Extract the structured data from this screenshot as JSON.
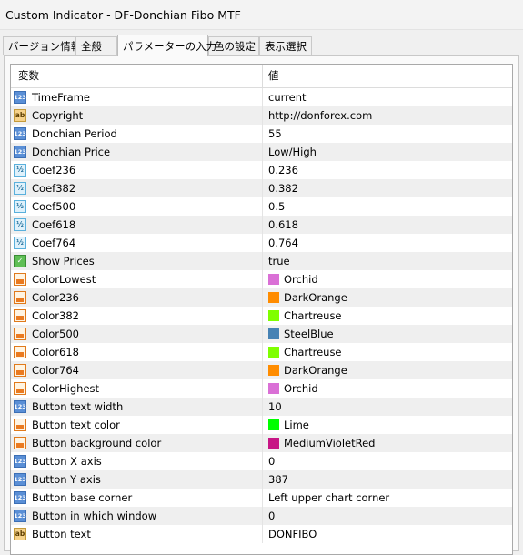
{
  "window": {
    "title": "Custom Indicator - DF-Donchian Fibo MTF"
  },
  "tabs": [
    {
      "label": "バージョン情報"
    },
    {
      "label": "全般"
    },
    {
      "label": "パラメーターの入力"
    },
    {
      "label": "色の設定"
    },
    {
      "label": "表示選択"
    }
  ],
  "grid": {
    "header": {
      "variable": "変数",
      "value": "値"
    },
    "rows": [
      {
        "icon": "int-icon",
        "name": "TimeFrame",
        "value": "current"
      },
      {
        "icon": "string-icon",
        "name": "Copyright",
        "value": "http://donforex.com"
      },
      {
        "icon": "int-icon",
        "name": "Donchian Period",
        "value": "55"
      },
      {
        "icon": "int-icon",
        "name": "Donchian Price",
        "value": "Low/High"
      },
      {
        "icon": "double-icon",
        "name": "Coef236",
        "value": "0.236"
      },
      {
        "icon": "double-icon",
        "name": "Coef382",
        "value": "0.382"
      },
      {
        "icon": "double-icon",
        "name": "Coef500",
        "value": "0.5"
      },
      {
        "icon": "double-icon",
        "name": "Coef618",
        "value": "0.618"
      },
      {
        "icon": "double-icon",
        "name": "Coef764",
        "value": "0.764"
      },
      {
        "icon": "bool-icon",
        "name": "Show Prices",
        "value": "true"
      },
      {
        "icon": "color-icon",
        "name": "ColorLowest",
        "value": "Orchid",
        "swatch": "#da70d6"
      },
      {
        "icon": "color-icon",
        "name": "Color236",
        "value": "DarkOrange",
        "swatch": "#ff8c00"
      },
      {
        "icon": "color-icon",
        "name": "Color382",
        "value": "Chartreuse",
        "swatch": "#7fff00"
      },
      {
        "icon": "color-icon",
        "name": "Color500",
        "value": "SteelBlue",
        "swatch": "#4682b4"
      },
      {
        "icon": "color-icon",
        "name": "Color618",
        "value": "Chartreuse",
        "swatch": "#7fff00"
      },
      {
        "icon": "color-icon",
        "name": "Color764",
        "value": "DarkOrange",
        "swatch": "#ff8c00"
      },
      {
        "icon": "color-icon",
        "name": "ColorHighest",
        "value": "Orchid",
        "swatch": "#da70d6"
      },
      {
        "icon": "int-icon",
        "name": "Button text width",
        "value": "10"
      },
      {
        "icon": "color-icon",
        "name": "Button text color",
        "value": "Lime",
        "swatch": "#00ff00"
      },
      {
        "icon": "color-icon",
        "name": "Button background color",
        "value": "MediumVioletRed",
        "swatch": "#c71585"
      },
      {
        "icon": "int-icon",
        "name": "Button X axis",
        "value": "0"
      },
      {
        "icon": "int-icon",
        "name": "Button Y axis",
        "value": "387"
      },
      {
        "icon": "int-icon",
        "name": "Button base corner",
        "value": "Left upper chart corner"
      },
      {
        "icon": "int-icon",
        "name": "Button in which window",
        "value": "0"
      },
      {
        "icon": "string-icon",
        "name": "Button text",
        "value": "DONFIBO"
      }
    ]
  }
}
